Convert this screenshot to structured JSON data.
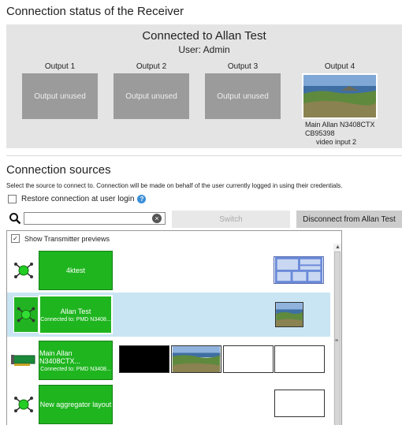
{
  "header": {
    "title": "Connection status of the Receiver"
  },
  "status": {
    "connected_to": "Connected to Allan Test",
    "user": "User: Admin",
    "outputs": [
      {
        "label": "Output 1",
        "state": "Output unused"
      },
      {
        "label": "Output 2",
        "state": "Output unused"
      },
      {
        "label": "Output 3",
        "state": "Output unused"
      },
      {
        "label": "Output 4",
        "info_line1": "Main Allan N3408CTX",
        "info_line2": "CB95398",
        "info_line3": "video input 2"
      }
    ]
  },
  "sources": {
    "title": "Connection sources",
    "hint": "Select the source to connect to. Connection will be made on behalf of the user currently logged in using their credentials.",
    "restore_label": "Restore connection at user login",
    "restore_checked": false,
    "search": {
      "value": "",
      "placeholder": ""
    },
    "switch_label": "Switch",
    "disconnect_label": "Disconnect from Allan Test",
    "show_previews_label": "Show Transmitter previews",
    "show_previews_checked": true,
    "items": [
      {
        "name": "4ktest",
        "sub": "",
        "icon": "aggregator-icon"
      },
      {
        "name": "Allan Test",
        "sub": "Connected to: PMD N3408...",
        "icon": "aggregator-icon",
        "selected": true
      },
      {
        "name": "Main Allan N3408CTX...",
        "sub": "Connected to: PMD N3408...",
        "icon": "transmitter-card-icon"
      },
      {
        "name": "New aggregator layout",
        "sub": "",
        "icon": "aggregator-icon"
      }
    ]
  },
  "colors": {
    "tile_green": "#1fb51f",
    "selected_row": "#c9e5f3",
    "status_panel": "#e4e4e4",
    "unused_output": "#9b9b9b",
    "help_blue": "#3c8fd8"
  }
}
